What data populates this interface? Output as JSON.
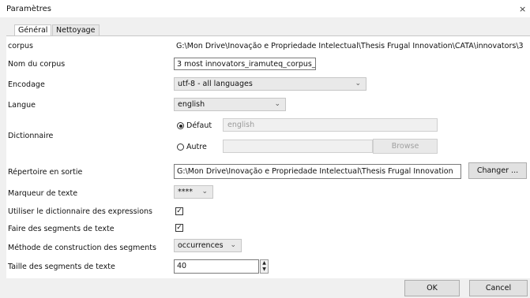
{
  "window": {
    "title": "Paramètres",
    "close_glyph": "×"
  },
  "tabs": [
    {
      "label": "Général"
    },
    {
      "label": "Nettoyage"
    }
  ],
  "fields": {
    "corpus": {
      "label": "corpus",
      "value": "G:\\Mon Drive\\Inovação e Propriedade Intelectual\\Thesis Frugal Innovation\\CATA\\innovators\\3"
    },
    "nom_corpus": {
      "label": "Nom du corpus",
      "value": "3 most innovators_iramuteq_corpus_"
    },
    "encodage": {
      "label": "Encodage",
      "value": "utf-8 - all languages"
    },
    "langue": {
      "label": "Langue",
      "value": "english"
    },
    "dictionnaire": {
      "label": "Dictionnaire",
      "default_label": "Défaut",
      "default_value": "english",
      "default_selected": true,
      "other_label": "Autre",
      "other_value": "",
      "browse_label": "Browse"
    },
    "repertoire": {
      "label": "Répertoire en sortie",
      "value": "G:\\Mon Drive\\Inovação e Propriedade Intelectual\\Thesis Frugal Innovation",
      "button": "Changer ..."
    },
    "marqueur": {
      "label": "Marqueur de texte",
      "value": "****"
    },
    "dict_expressions": {
      "label": "Utiliser le dictionnaire des expressions",
      "checked": true,
      "mark": "✓"
    },
    "segments": {
      "label": "Faire des segments de texte",
      "checked": true,
      "mark": "✓"
    },
    "methode": {
      "label": "Méthode de construction des segments",
      "value": "occurrences"
    },
    "taille": {
      "label": "Taille des segments de texte",
      "value": "40"
    }
  },
  "footer": {
    "ok": "OK",
    "cancel": "Cancel"
  },
  "icons": {
    "chevron": "chevron-down-icon",
    "close": "close-icon"
  }
}
